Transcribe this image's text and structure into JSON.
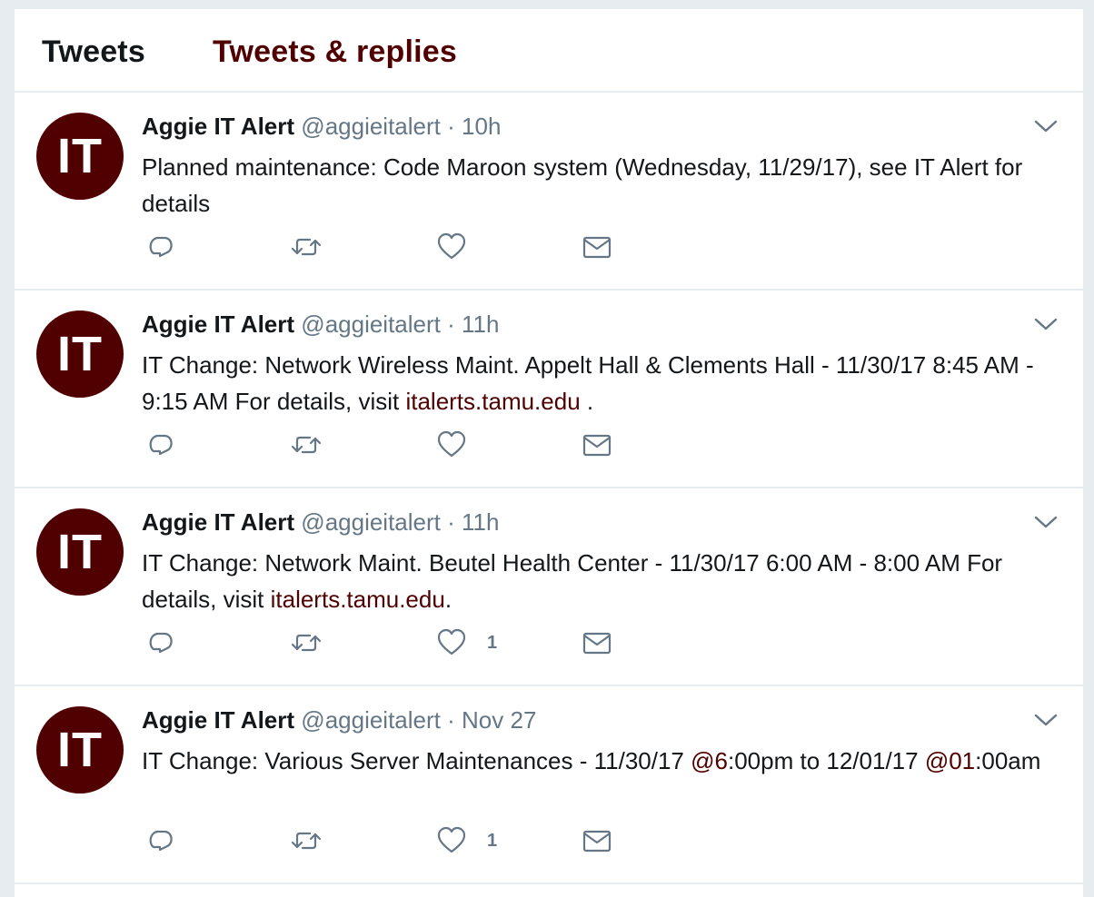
{
  "tabs": [
    "Tweets",
    "Tweets & replies"
  ],
  "tweets": [
    {
      "avatar": "IT",
      "name": "Aggie IT Alert",
      "handle": "@aggieitalert",
      "sep": "·",
      "time": "10h",
      "segments": [
        {
          "t": "Planned maintenance: Code Maroon system (Wednesday, 11/29/17), see IT Alert for details",
          "link": false
        }
      ],
      "likes": ""
    },
    {
      "avatar": "IT",
      "name": "Aggie IT Alert",
      "handle": "@aggieitalert",
      "sep": "·",
      "time": "11h",
      "segments": [
        {
          "t": "IT Change: Network Wireless Maint. Appelt Hall & Clements Hall - 11/30/17 8:45 AM - 9:15 AM For details, visit ",
          "link": false
        },
        {
          "t": "italerts.tamu.edu",
          "link": true
        },
        {
          "t": " .",
          "link": false
        }
      ],
      "likes": ""
    },
    {
      "avatar": "IT",
      "name": "Aggie IT Alert",
      "handle": "@aggieitalert",
      "sep": "·",
      "time": "11h",
      "segments": [
        {
          "t": "IT Change: Network Maint. Beutel Health Center - 11/30/17 6:00 AM - 8:00 AM For details, visit ",
          "link": false
        },
        {
          "t": "italerts.tamu.edu",
          "link": true
        },
        {
          "t": ".",
          "link": false
        }
      ],
      "likes": "1"
    },
    {
      "avatar": "IT",
      "name": "Aggie IT Alert",
      "handle": "@aggieitalert",
      "sep": "·",
      "time": "Nov 27",
      "segments": [
        {
          "t": "IT Change: Various Server Maintenances - 11/30/17 ",
          "link": false
        },
        {
          "t": "@6",
          "link": true
        },
        {
          "t": ":00pm to 12/01/17 ",
          "link": false
        },
        {
          "t": "@01",
          "link": true
        },
        {
          "t": ":00am",
          "link": false
        }
      ],
      "likes": "1"
    }
  ],
  "icons": {
    "reply": "reply-icon",
    "retweet": "retweet-icon",
    "like": "heart-icon",
    "dm": "envelope-icon",
    "caret": "chevron-down-icon"
  },
  "colors": {
    "accent": "#500000",
    "muted": "#657786",
    "text": "#14171a",
    "background": "#e6ecf0"
  }
}
